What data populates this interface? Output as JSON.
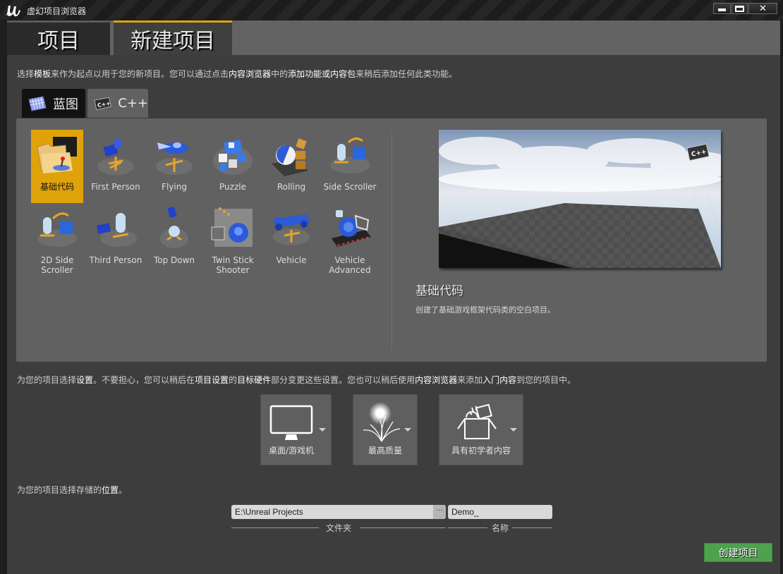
{
  "window": {
    "title": "虚幻项目浏览器",
    "logo_icon": "unreal-logo-icon",
    "controls": [
      "minimize",
      "maximize",
      "close"
    ]
  },
  "top_tabs": [
    {
      "label": "项目",
      "active": false
    },
    {
      "label": "新建项目",
      "active": true
    }
  ],
  "intro": {
    "p1": "选择",
    "b1": "模板",
    "p2": "来作为起点以用于您的新项目。您可以通过点击",
    "b2": "内容浏览器",
    "p3": "中的",
    "b3": "添加功能或内容包",
    "p4": "来稍后添加任何此类功能。"
  },
  "language_tabs": [
    {
      "label": "蓝图",
      "icon": "blueprint-icon",
      "active": true
    },
    {
      "label": "C++",
      "icon": "cpp-icon",
      "active": false
    }
  ],
  "templates": [
    {
      "label": "基础代码",
      "selected": true
    },
    {
      "label": "First Person",
      "selected": false
    },
    {
      "label": "Flying",
      "selected": false
    },
    {
      "label": "Puzzle",
      "selected": false
    },
    {
      "label": "Rolling",
      "selected": false
    },
    {
      "label": "Side Scroller",
      "selected": false
    },
    {
      "label": "2D Side Scroller",
      "selected": false
    },
    {
      "label": "Third Person",
      "selected": false
    },
    {
      "label": "Top Down",
      "selected": false
    },
    {
      "label": "Twin Stick Shooter",
      "selected": false
    },
    {
      "label": "Vehicle",
      "selected": false
    },
    {
      "label": "Vehicle Advanced",
      "selected": false
    }
  ],
  "preview": {
    "badge": "C++",
    "title": "基础代码",
    "description": "创建了基础游戏框架代码类的空白项目。"
  },
  "settings_intro": {
    "p1": "为您的项目选择",
    "b1": "设置",
    "p2": "。不要担心，您可以稍后在",
    "b2": "项目设置",
    "p3": "的",
    "b3": "目标硬件",
    "p4": "部分变更这些设置。您也可以稍后使用",
    "b4": "内容浏览器",
    "p5": "来添加",
    "b5": "入门内容",
    "p6": "到您的项目中。"
  },
  "settings_options": [
    {
      "label": "桌面/游戏机",
      "icon": "monitor-icon"
    },
    {
      "label": "最高质量",
      "icon": "quality-icon"
    },
    {
      "label": "具有初学者内容",
      "icon": "starter-content-icon"
    }
  ],
  "location": {
    "intro_p1": "为您的项目选择存储的",
    "intro_b1": "位置",
    "intro_p2": "。",
    "folder_value": "E:\\Unreal Projects",
    "browse_label": "···",
    "folder_caption": "文件夹",
    "name_value": "Demo_",
    "name_caption": "名称"
  },
  "create_button": "创建项目",
  "colors": {
    "accent": "#e0a20a",
    "create": "#4ea24e"
  }
}
